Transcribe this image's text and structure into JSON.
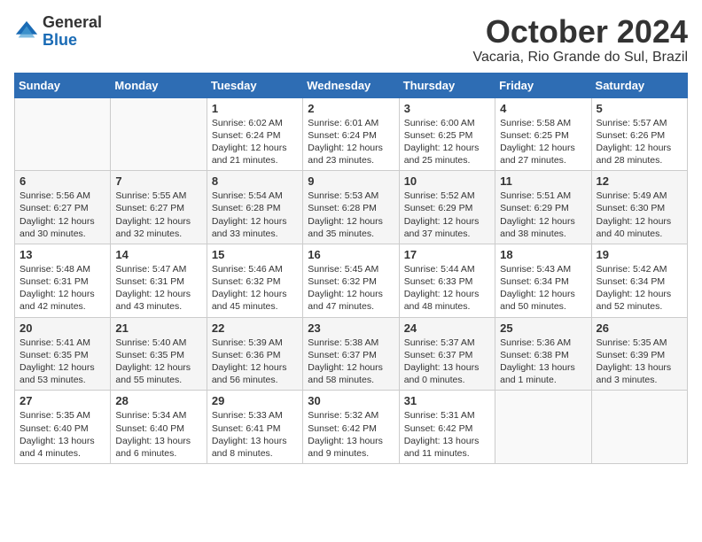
{
  "logo": {
    "general": "General",
    "blue": "Blue"
  },
  "title": "October 2024",
  "location": "Vacaria, Rio Grande do Sul, Brazil",
  "headers": [
    "Sunday",
    "Monday",
    "Tuesday",
    "Wednesday",
    "Thursday",
    "Friday",
    "Saturday"
  ],
  "rows": [
    [
      {
        "num": "",
        "info": ""
      },
      {
        "num": "",
        "info": ""
      },
      {
        "num": "1",
        "info": "Sunrise: 6:02 AM\nSunset: 6:24 PM\nDaylight: 12 hours and 21 minutes."
      },
      {
        "num": "2",
        "info": "Sunrise: 6:01 AM\nSunset: 6:24 PM\nDaylight: 12 hours and 23 minutes."
      },
      {
        "num": "3",
        "info": "Sunrise: 6:00 AM\nSunset: 6:25 PM\nDaylight: 12 hours and 25 minutes."
      },
      {
        "num": "4",
        "info": "Sunrise: 5:58 AM\nSunset: 6:25 PM\nDaylight: 12 hours and 27 minutes."
      },
      {
        "num": "5",
        "info": "Sunrise: 5:57 AM\nSunset: 6:26 PM\nDaylight: 12 hours and 28 minutes."
      }
    ],
    [
      {
        "num": "6",
        "info": "Sunrise: 5:56 AM\nSunset: 6:27 PM\nDaylight: 12 hours and 30 minutes."
      },
      {
        "num": "7",
        "info": "Sunrise: 5:55 AM\nSunset: 6:27 PM\nDaylight: 12 hours and 32 minutes."
      },
      {
        "num": "8",
        "info": "Sunrise: 5:54 AM\nSunset: 6:28 PM\nDaylight: 12 hours and 33 minutes."
      },
      {
        "num": "9",
        "info": "Sunrise: 5:53 AM\nSunset: 6:28 PM\nDaylight: 12 hours and 35 minutes."
      },
      {
        "num": "10",
        "info": "Sunrise: 5:52 AM\nSunset: 6:29 PM\nDaylight: 12 hours and 37 minutes."
      },
      {
        "num": "11",
        "info": "Sunrise: 5:51 AM\nSunset: 6:29 PM\nDaylight: 12 hours and 38 minutes."
      },
      {
        "num": "12",
        "info": "Sunrise: 5:49 AM\nSunset: 6:30 PM\nDaylight: 12 hours and 40 minutes."
      }
    ],
    [
      {
        "num": "13",
        "info": "Sunrise: 5:48 AM\nSunset: 6:31 PM\nDaylight: 12 hours and 42 minutes."
      },
      {
        "num": "14",
        "info": "Sunrise: 5:47 AM\nSunset: 6:31 PM\nDaylight: 12 hours and 43 minutes."
      },
      {
        "num": "15",
        "info": "Sunrise: 5:46 AM\nSunset: 6:32 PM\nDaylight: 12 hours and 45 minutes."
      },
      {
        "num": "16",
        "info": "Sunrise: 5:45 AM\nSunset: 6:32 PM\nDaylight: 12 hours and 47 minutes."
      },
      {
        "num": "17",
        "info": "Sunrise: 5:44 AM\nSunset: 6:33 PM\nDaylight: 12 hours and 48 minutes."
      },
      {
        "num": "18",
        "info": "Sunrise: 5:43 AM\nSunset: 6:34 PM\nDaylight: 12 hours and 50 minutes."
      },
      {
        "num": "19",
        "info": "Sunrise: 5:42 AM\nSunset: 6:34 PM\nDaylight: 12 hours and 52 minutes."
      }
    ],
    [
      {
        "num": "20",
        "info": "Sunrise: 5:41 AM\nSunset: 6:35 PM\nDaylight: 12 hours and 53 minutes."
      },
      {
        "num": "21",
        "info": "Sunrise: 5:40 AM\nSunset: 6:35 PM\nDaylight: 12 hours and 55 minutes."
      },
      {
        "num": "22",
        "info": "Sunrise: 5:39 AM\nSunset: 6:36 PM\nDaylight: 12 hours and 56 minutes."
      },
      {
        "num": "23",
        "info": "Sunrise: 5:38 AM\nSunset: 6:37 PM\nDaylight: 12 hours and 58 minutes."
      },
      {
        "num": "24",
        "info": "Sunrise: 5:37 AM\nSunset: 6:37 PM\nDaylight: 13 hours and 0 minutes."
      },
      {
        "num": "25",
        "info": "Sunrise: 5:36 AM\nSunset: 6:38 PM\nDaylight: 13 hours and 1 minute."
      },
      {
        "num": "26",
        "info": "Sunrise: 5:35 AM\nSunset: 6:39 PM\nDaylight: 13 hours and 3 minutes."
      }
    ],
    [
      {
        "num": "27",
        "info": "Sunrise: 5:35 AM\nSunset: 6:40 PM\nDaylight: 13 hours and 4 minutes."
      },
      {
        "num": "28",
        "info": "Sunrise: 5:34 AM\nSunset: 6:40 PM\nDaylight: 13 hours and 6 minutes."
      },
      {
        "num": "29",
        "info": "Sunrise: 5:33 AM\nSunset: 6:41 PM\nDaylight: 13 hours and 8 minutes."
      },
      {
        "num": "30",
        "info": "Sunrise: 5:32 AM\nSunset: 6:42 PM\nDaylight: 13 hours and 9 minutes."
      },
      {
        "num": "31",
        "info": "Sunrise: 5:31 AM\nSunset: 6:42 PM\nDaylight: 13 hours and 11 minutes."
      },
      {
        "num": "",
        "info": ""
      },
      {
        "num": "",
        "info": ""
      }
    ]
  ]
}
